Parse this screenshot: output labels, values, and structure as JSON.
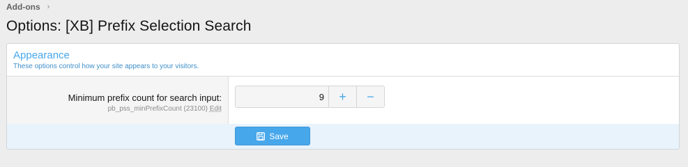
{
  "breadcrumb": {
    "label": "Add-ons",
    "separator": "›"
  },
  "page": {
    "title": "Options: [XB] Prefix Selection Search"
  },
  "block": {
    "title": "Appearance",
    "description": "These options control how your site appears to your visitors."
  },
  "option": {
    "label": "Minimum prefix count for search input:",
    "hint_prefix": "pb_pss_minPrefixCount (23100)",
    "edit_label": "Edit",
    "value": "9",
    "increment_icon": "plus-icon",
    "decrement_icon": "minus-icon",
    "increment_glyph": "+",
    "decrement_glyph": "−"
  },
  "footer": {
    "save_label": "Save",
    "save_icon": "floppy-disk-icon"
  },
  "colors": {
    "accent": "#47a7eb",
    "footer_bg": "#e8f3fc",
    "page_bg": "#ededed"
  }
}
